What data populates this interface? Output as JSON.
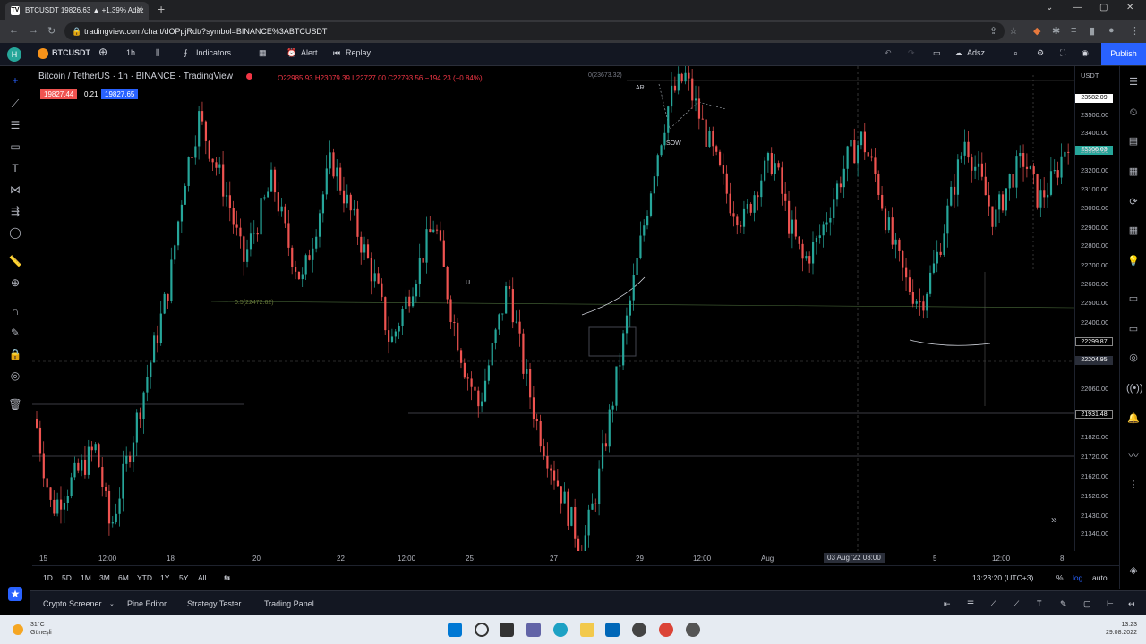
{
  "browser": {
    "tab_title": "BTCUSDT 19826.63 ▲ +1.39% Adsz",
    "url": "tradingview.com/chart/dOPpjRdt/?symbol=BINANCE%3ABTCUSDT"
  },
  "header": {
    "symbol": "BTCUSDT",
    "interval": "1h",
    "indicators_label": "Indicators",
    "alert_label": "Alert",
    "replay_label": "Replay",
    "layout_name": "Adsz",
    "publish_label": "Publish"
  },
  "legend": {
    "title": "Bitcoin / TetherUS · 1h · BINANCE · TradingView",
    "ohlc": "O22985.93 H23079.39 L22727.00 C22793.56 −194.23 (−0.84%)",
    "bid": "19827.44",
    "spread": "0.21",
    "ask": "19827.65"
  },
  "chart_annotations": {
    "fib_label": "0.5(22472.62)",
    "level_top": "0(23673.32)",
    "ar_label": "AR",
    "sow_label": "SOW",
    "u_label": "U",
    "crosshair_date": "03 Aug '22  03:00"
  },
  "price_axis": {
    "currency": "USDT",
    "labels": [
      "23500.00",
      "23400.00",
      "23300.00",
      "23200.00",
      "23100.00",
      "23000.00",
      "22900.00",
      "22800.00",
      "22700.00",
      "22600.00",
      "22500.00",
      "22400.00",
      "22060.00",
      "21820.00",
      "21720.00",
      "21620.00",
      "21520.00",
      "21430.00",
      "21340.00"
    ],
    "badge_top": "23582.09",
    "badge_mid": "23306.63",
    "badge_red1": "22299.87",
    "badge_cross": "22204.95",
    "badge_red2": "21931.48"
  },
  "time_axis": {
    "labels": [
      "15",
      "12:00",
      "18",
      "20",
      "22",
      "12:00",
      "25",
      "27",
      "29",
      "12:00",
      "Aug",
      "5",
      "12:00",
      "8"
    ]
  },
  "range_bar": {
    "ranges": [
      "1D",
      "5D",
      "1M",
      "3M",
      "6M",
      "YTD",
      "1Y",
      "5Y",
      "All"
    ],
    "clock": "13:23:20 (UTC+3)",
    "pct": "%",
    "log": "log",
    "auto": "auto"
  },
  "panels": {
    "items": [
      "Crypto Screener",
      "Pine Editor",
      "Strategy Tester",
      "Trading Panel"
    ]
  },
  "taskbar": {
    "temp": "31°C",
    "weather": "Güneşli",
    "time": "13:23",
    "date": "29.08.2022"
  },
  "colors": {
    "up": "#26a69a",
    "down": "#ef5350",
    "accent": "#2962ff"
  },
  "chart_data": {
    "type": "candlestick",
    "symbol": "BTCUSDT",
    "interval": "1h",
    "ylim": [
      21300,
      23650
    ],
    "closes": [
      21900,
      21500,
      21600,
      21700,
      21800,
      21400,
      21700,
      22000,
      22300,
      22600,
      23100,
      23400,
      23200,
      23000,
      22700,
      22900,
      23100,
      22800,
      22600,
      22900,
      23200,
      23000,
      22800,
      22600,
      22300,
      22500,
      22700,
      22900,
      22500,
      22200,
      22000,
      22300,
      22600,
      22200,
      21900,
      21700,
      21500,
      21300,
      21600,
      22000,
      22400,
      22800,
      23200,
      23500,
      23600,
      23400,
      23200,
      23000,
      22900,
      23100,
      23200,
      22900,
      22700,
      22800,
      23000,
      23200,
      23300,
      23100,
      22800,
      22600,
      22500,
      22700,
      23000,
      23300,
      23100,
      22900,
      23100,
      23200,
      23000,
      23100,
      23300
    ]
  }
}
